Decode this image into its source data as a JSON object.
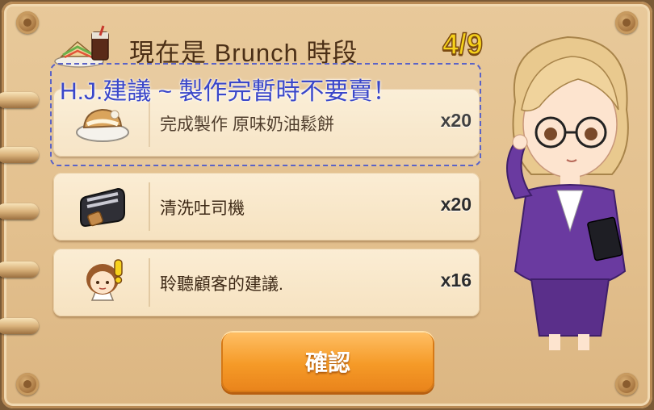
{
  "header": {
    "title": "現在是 Brunch 時段",
    "progress": "4/9"
  },
  "annotation": {
    "text": "H.J.建議 ~ 製作完暫時不要賣！"
  },
  "tasks": [
    {
      "label": "完成製作 原味奶油鬆餅",
      "count": "x20",
      "icon": "waffle-plate-icon"
    },
    {
      "label": "清洗吐司機",
      "count": "x20",
      "icon": "toaster-icon"
    },
    {
      "label": "聆聽顧客的建議.",
      "count": "x16",
      "icon": "customer-alert-icon"
    }
  ],
  "actions": {
    "confirm_label": "確認"
  },
  "colors": {
    "board": "#e3c08e",
    "card": "#f6e2c0",
    "progress": "#f6d21a",
    "note": "#3a47c9",
    "button": "#f59a27"
  }
}
